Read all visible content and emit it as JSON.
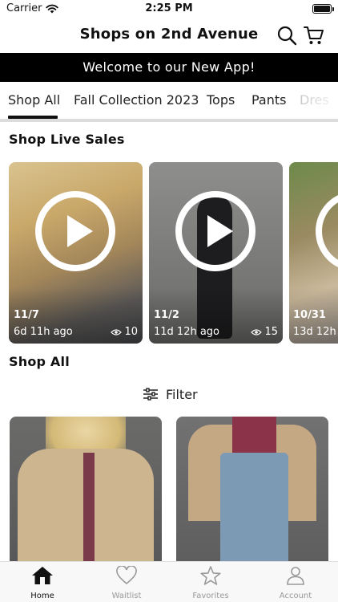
{
  "status_bar": {
    "carrier": "Carrier",
    "time": "2:25 PM"
  },
  "header": {
    "title": "Shops on 2nd Avenue",
    "icons": [
      "search-icon",
      "cart-icon"
    ]
  },
  "banner": {
    "text": "Welcome to our New App!"
  },
  "tabs": [
    {
      "label": "Shop All",
      "active": true
    },
    {
      "label": "Fall Collection 2023",
      "active": false
    },
    {
      "label": "Tops",
      "active": false
    },
    {
      "label": "Pants",
      "active": false
    },
    {
      "label": "Dres",
      "active": false
    }
  ],
  "live_sales": {
    "title": "Shop Live Sales",
    "items": [
      {
        "date": "11/7",
        "ago": "6d 11h ago",
        "views": "10"
      },
      {
        "date": "11/2",
        "ago": "11d 12h ago",
        "views": "15"
      },
      {
        "date": "10/31",
        "ago": "13d 12h",
        "views": ""
      }
    ]
  },
  "shop_all": {
    "title": "Shop All",
    "filter_label": "Filter"
  },
  "tabbar": {
    "items": [
      {
        "label": "Home",
        "icon": "home-icon",
        "active": true
      },
      {
        "label": "Waitlist",
        "icon": "heart-icon",
        "active": false
      },
      {
        "label": "Favorites",
        "icon": "star-icon",
        "active": false
      },
      {
        "label": "Account",
        "icon": "person-icon",
        "active": false
      }
    ]
  },
  "colors": {
    "banner_bg": "#000000",
    "accent": "#111111",
    "inactive_tab": "#999999"
  }
}
